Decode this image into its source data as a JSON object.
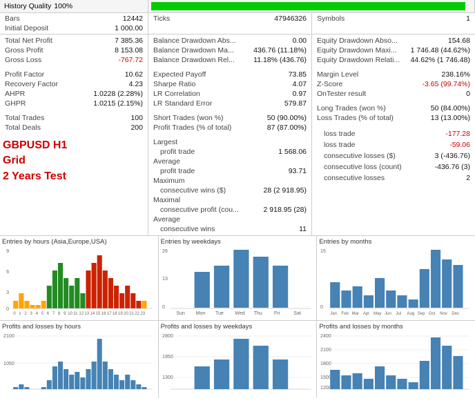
{
  "header": {
    "historyQuality": "100%",
    "historyQualityLabel": "History Quality",
    "bars": "12442",
    "barsLabel": "Bars",
    "ticks": "47946326",
    "ticksLabel": "Ticks",
    "symbols": "1",
    "symbolsLabel": "Symbols",
    "initialDeposit": "1 000.00",
    "initialDepositLabel": "Initial Deposit"
  },
  "leftStats": [
    {
      "label": "Total Net Profit",
      "value": "7 385.36",
      "neg": false
    },
    {
      "label": "Gross Profit",
      "value": "8 153.08",
      "neg": false
    },
    {
      "label": "Gross Loss",
      "value": "-767.72",
      "neg": true
    },
    {
      "spacer": true
    },
    {
      "label": "Profit Factor",
      "value": "10.62",
      "neg": false
    },
    {
      "label": "Recovery Factor",
      "value": "4.23",
      "neg": false
    },
    {
      "label": "AHPR",
      "value": "1.0228 (2.28%)",
      "neg": false
    },
    {
      "label": "GHPR",
      "value": "1.0215 (2.15%)",
      "neg": false
    },
    {
      "spacer": true
    },
    {
      "label": "Total Trades",
      "value": "100",
      "neg": false
    },
    {
      "label": "Total Deals",
      "value": "200",
      "neg": false
    }
  ],
  "middleStats": [
    {
      "label": "Balance Drawdown Abs...",
      "value": "0.00",
      "neg": false
    },
    {
      "label": "Balance Drawdown Ma...",
      "value": "436.76 (11.18%)",
      "neg": false
    },
    {
      "label": "Balance Drawdown Rel...",
      "value": "11.18% (436.76)",
      "neg": false
    },
    {
      "spacer": true
    },
    {
      "label": "Expected Payoff",
      "value": "73.85",
      "neg": false
    },
    {
      "label": "Sharpe Ratio",
      "value": "4.07",
      "neg": false
    },
    {
      "label": "LR Correlation",
      "value": "0.97",
      "neg": false
    },
    {
      "label": "LR Standard Error",
      "value": "579.87",
      "neg": false
    },
    {
      "spacer": true
    },
    {
      "label": "Short Trades (won %)",
      "value": "50 (90.00%)",
      "neg": false
    },
    {
      "label": "Profit Trades (% of total)",
      "value": "87 (87.00%)",
      "neg": false
    },
    {
      "spacer": true
    },
    {
      "label": "Largest",
      "value": "",
      "neg": false
    },
    {
      "label": "  Average",
      "value": "",
      "neg": false,
      "sub": true
    },
    {
      "label": "Maximal",
      "value": "",
      "neg": false
    },
    {
      "label": "  Maximal consecutive profit (cou...",
      "value": "",
      "neg": false,
      "sub": true
    },
    {
      "label": "  Average",
      "value": "",
      "neg": false,
      "sub": true
    },
    {
      "label": "  consecutive wins",
      "value": "11",
      "neg": false,
      "sub": true
    }
  ],
  "middleStatsDetailed": [
    {
      "label": "Balance Drawdown Abs...",
      "value": "0.00"
    },
    {
      "label": "Balance Drawdown Ma...",
      "value": "436.76 (11.18%)"
    },
    {
      "label": "Balance Drawdown Rel...",
      "value": "11.18% (436.76)"
    },
    {
      "spacer": true
    },
    {
      "label": "Expected Payoff",
      "value": "73.85"
    },
    {
      "label": "Sharpe Ratio",
      "value": "4.07"
    },
    {
      "label": "LR Correlation",
      "value": "0.97"
    },
    {
      "label": "LR Standard Error",
      "value": "579.87"
    },
    {
      "spacer": true
    },
    {
      "label": "Short Trades (won %)",
      "value": "50 (90.00%)"
    },
    {
      "label": "Profit Trades (% of total)",
      "value": "87 (87.00%)"
    },
    {
      "spacer": true
    },
    {
      "label": "Largest    profit trade",
      "value": "1 568.06"
    },
    {
      "label": "             profit trade",
      "value": "93.71"
    },
    {
      "label": "Maximum  consecutive wins ($)",
      "value": "28 (2 918.95)"
    },
    {
      "label": "Maximal  consecutive profit (cou...",
      "value": "2 918.95 (28)"
    },
    {
      "label": "Average  consecutive wins",
      "value": "11"
    }
  ],
  "rightStats": [
    {
      "label": "Equity Drawdown Abso...",
      "value": "154.68"
    },
    {
      "label": "Equity Drawdown Maxi...",
      "value": "1 746.48 (44.62%)"
    },
    {
      "label": "Equity Drawdown Relati...",
      "value": "44.62% (1 746.48)"
    },
    {
      "spacer": true
    },
    {
      "label": "Margin Level",
      "value": "238.16%"
    },
    {
      "label": "Z-Score",
      "value": "-3.65 (99.74%)",
      "neg": true
    },
    {
      "label": "OnTester result",
      "value": "0"
    },
    {
      "spacer": true
    },
    {
      "label": "Long Trades (won %)",
      "value": "50 (84.00%)"
    },
    {
      "label": "Loss Trades (% of total)",
      "value": "13 (13.00%)"
    },
    {
      "spacer": true
    },
    {
      "label": "loss trade",
      "value": "-177.28",
      "neg": true
    },
    {
      "label": "loss trade",
      "value": "-59.06",
      "neg": true
    },
    {
      "label": "consecutive losses ($)",
      "value": "3 (-436.76)"
    },
    {
      "label": "consecutive loss (count)",
      "value": "-436.76 (3)"
    },
    {
      "label": "consecutive losses",
      "value": "2"
    }
  ],
  "overlay": {
    "line1": "GBPUSD H1",
    "line2": "Grid",
    "line3": "2 Years Test"
  },
  "charts": {
    "entriesByHours": {
      "title": "Entries by hours (Asia,Europe,USA)",
      "yMax": 9,
      "yLabels": [
        "9",
        "6",
        "3",
        "0"
      ],
      "xLabels": [
        "0",
        "1",
        "2",
        "3",
        "4",
        "5",
        "6",
        "7",
        "8",
        "9",
        "10",
        "11",
        "12",
        "13",
        "14",
        "15",
        "16",
        "17",
        "18",
        "19",
        "20",
        "21",
        "22",
        "23"
      ],
      "bars": [
        {
          "height": 2,
          "color": "#ffa500"
        },
        {
          "height": 3,
          "color": "#ffa500"
        },
        {
          "height": 2,
          "color": "#ffa500"
        },
        {
          "height": 1,
          "color": "#ffa500"
        },
        {
          "height": 1,
          "color": "#ffa500"
        },
        {
          "height": 2,
          "color": "#ffa500"
        },
        {
          "height": 4,
          "color": "#228b22"
        },
        {
          "height": 6,
          "color": "#228b22"
        },
        {
          "height": 7,
          "color": "#228b22"
        },
        {
          "height": 5,
          "color": "#228b22"
        },
        {
          "height": 4,
          "color": "#228b22"
        },
        {
          "height": 5,
          "color": "#228b22"
        },
        {
          "height": 3,
          "color": "#228b22"
        },
        {
          "height": 6,
          "color": "#cc2200"
        },
        {
          "height": 7,
          "color": "#cc2200"
        },
        {
          "height": 8,
          "color": "#cc2200"
        },
        {
          "height": 6,
          "color": "#cc2200"
        },
        {
          "height": 5,
          "color": "#cc2200"
        },
        {
          "height": 4,
          "color": "#cc2200"
        },
        {
          "height": 3,
          "color": "#cc2200"
        },
        {
          "height": 4,
          "color": "#cc2200"
        },
        {
          "height": 3,
          "color": "#cc2200"
        },
        {
          "height": 2,
          "color": "#cc2200"
        },
        {
          "height": 2,
          "color": "#ffa500"
        }
      ]
    },
    "entriesByWeekdays": {
      "title": "Entries by weekdays",
      "yMax": 26,
      "yLabels": [
        "26",
        "13",
        "0"
      ],
      "xLabels": [
        "Sun",
        "Mon",
        "Tue",
        "Wed",
        "Thu",
        "Fri",
        "Sat"
      ],
      "bars": [
        {
          "height": 0,
          "color": "#4682b4"
        },
        {
          "height": 16,
          "color": "#4682b4"
        },
        {
          "height": 18,
          "color": "#4682b4"
        },
        {
          "height": 26,
          "color": "#4682b4"
        },
        {
          "height": 22,
          "color": "#4682b4"
        },
        {
          "height": 18,
          "color": "#4682b4"
        },
        {
          "height": 0,
          "color": "#4682b4"
        }
      ]
    },
    "entriesByMonths": {
      "title": "Entries by months",
      "yMax": 15,
      "yLabels": [
        "15",
        "0"
      ],
      "xLabels": [
        "Jan",
        "Feb",
        "Mar",
        "Apr",
        "May",
        "Jun",
        "Jul",
        "Aug",
        "Sep",
        "Oct",
        "Nov",
        "Dec"
      ],
      "bars": [
        {
          "height": 6,
          "color": "#4682b4"
        },
        {
          "height": 4,
          "color": "#4682b4"
        },
        {
          "height": 5,
          "color": "#4682b4"
        },
        {
          "height": 3,
          "color": "#4682b4"
        },
        {
          "height": 7,
          "color": "#4682b4"
        },
        {
          "height": 4,
          "color": "#4682b4"
        },
        {
          "height": 3,
          "color": "#4682b4"
        },
        {
          "height": 2,
          "color": "#4682b4"
        },
        {
          "height": 9,
          "color": "#4682b4"
        },
        {
          "height": 15,
          "color": "#4682b4"
        },
        {
          "height": 12,
          "color": "#4682b4"
        },
        {
          "height": 10,
          "color": "#4682b4"
        }
      ]
    },
    "profitByHours": {
      "title": "Profits and losses by hours",
      "yLabels": [
        "2100",
        "1050"
      ],
      "bars": [
        1,
        2,
        1,
        0,
        0,
        1,
        3,
        8,
        10,
        7,
        5,
        6,
        4,
        12,
        18,
        22,
        15,
        10,
        8,
        6,
        7,
        5,
        4,
        3
      ]
    },
    "profitByWeekdays": {
      "title": "Profits and losses by weekdays",
      "yLabels": [
        "2800",
        "1950",
        "1300"
      ],
      "bars": [
        0,
        14,
        18,
        26,
        20,
        16,
        0
      ]
    },
    "profitByMonths": {
      "title": "Profits and losses by months",
      "yLabels": [
        "2400",
        "2100",
        "1800",
        "1500",
        "1200"
      ],
      "bars": [
        8,
        5,
        7,
        4,
        9,
        5,
        4,
        3,
        11,
        20,
        16,
        13
      ]
    }
  }
}
